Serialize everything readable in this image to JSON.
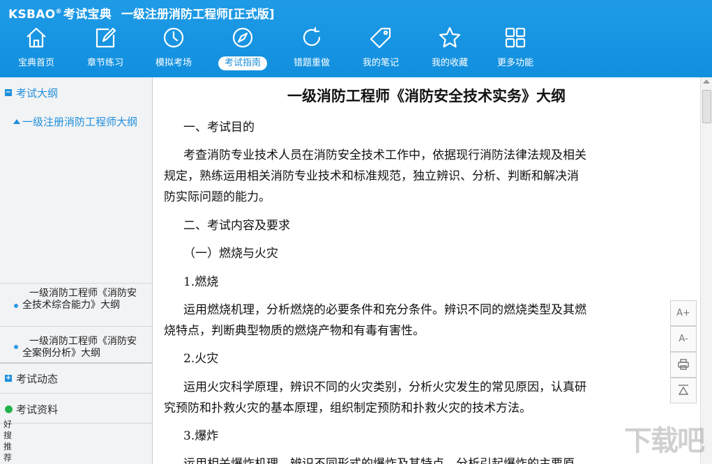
{
  "header": {
    "logo": "KSBAO",
    "logo_reg": "®",
    "brand_name": "考试宝典",
    "app_title": "一级注册消防工程师[正式版]"
  },
  "nav": [
    {
      "label": "宝典首页",
      "icon": "home-icon"
    },
    {
      "label": "章节练习",
      "icon": "edit-icon"
    },
    {
      "label": "模拟考场",
      "icon": "clock-icon"
    },
    {
      "label": "考试指南",
      "icon": "compass-icon",
      "active": true
    },
    {
      "label": "错题重做",
      "icon": "refresh-icon"
    },
    {
      "label": "我的笔记",
      "icon": "tag-icon"
    },
    {
      "label": "我的收藏",
      "icon": "star-icon"
    },
    {
      "label": "更多功能",
      "icon": "grid-icon"
    }
  ],
  "sidebar": {
    "section1": {
      "box": "−",
      "label": "考试大纲"
    },
    "sub1": {
      "label": "一级注册消防工程师大纲"
    },
    "items": [
      {
        "label": "一级消防工程师《消防安全技术综合能力》大纲"
      },
      {
        "label": "一级消防工程师《消防安全案例分析》大纲"
      }
    ],
    "section2": {
      "box": "+",
      "label": "考试动态"
    },
    "section3": {
      "label": "考试资料"
    },
    "recommend": "好搜推荐"
  },
  "document": {
    "title": "一级消防工程师《消防安全技术实务》大纲",
    "lines": [
      "一、考试目的",
      "考查消防专业技术人员在消防安全技术工作中，依据现行消防法律法规及相关",
      "规定，熟练运用相关消防专业技术和标准规范，独立辨识、分析、判断和解决消",
      "防实际问题的能力。",
      "二、考试内容及要求",
      "（一）燃烧与火灾",
      "1.燃烧",
      "运用燃烧机理，分析燃烧的必要条件和充分条件。辨识不同的燃烧类型及其燃",
      "烧特点，判断典型物质的燃烧产物和有毒有害性。",
      "2.火灾",
      "运用火灾科学原理，辨识不同的火灾类别，分析火灾发生的常见原因，认真研",
      "究预防和扑救火灾的基本原理，组织制定预防和扑救火灾的技术方法。",
      "3.爆炸",
      "运用相关爆炸机理，辨识不同形式的爆炸及其特点，分析引起爆炸的主要原"
    ]
  },
  "tools": {
    "font_increase": "A+",
    "font_decrease": "A-"
  },
  "watermark": "下载吧",
  "colors": {
    "header": "#1693e0",
    "accent": "#1e8fdc",
    "sidebar_bg": "#f2f3f5"
  }
}
